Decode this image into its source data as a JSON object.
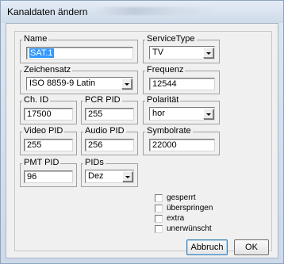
{
  "window": {
    "title": "Kanaldaten ändern"
  },
  "name": {
    "label": "Name",
    "value": "SAT.1"
  },
  "service_type": {
    "label": "ServiceType",
    "value": "TV"
  },
  "zeichensatz": {
    "label": "Zeichensatz",
    "value": "ISO 8859-9 Latin"
  },
  "frequenz": {
    "label": "Frequenz",
    "value": "12544"
  },
  "ch_id": {
    "label": "Ch. ID",
    "value": "17500"
  },
  "pcr_pid": {
    "label": "PCR PID",
    "value": "255"
  },
  "polaritaet": {
    "label": "Polarität",
    "value": "hor"
  },
  "video_pid": {
    "label": "Video PID",
    "value": "255"
  },
  "audio_pid": {
    "label": "Audio PID",
    "value": "256"
  },
  "symbolrate": {
    "label": "Symbolrate",
    "value": "22000"
  },
  "pmt_pid": {
    "label": "PMT PID",
    "value": "96"
  },
  "pids": {
    "label": "PIDs",
    "value": "Dez"
  },
  "checkboxes": [
    {
      "label": "gesperrt",
      "checked": false
    },
    {
      "label": "überspringen",
      "checked": false
    },
    {
      "label": "extra",
      "checked": false
    },
    {
      "label": "unerwünscht",
      "checked": false
    }
  ],
  "buttons": {
    "cancel": "Abbruch",
    "ok": "OK"
  }
}
